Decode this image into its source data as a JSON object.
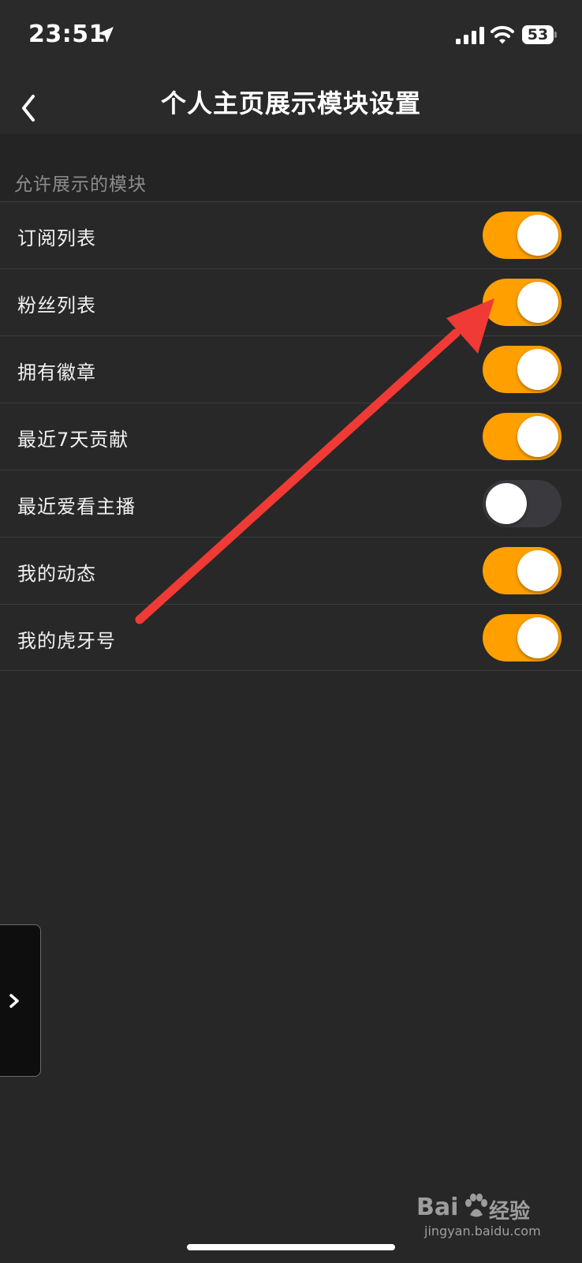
{
  "status_bar": {
    "time": "23:51",
    "battery": "53",
    "icons": [
      "location-arrow-icon",
      "signal-bars-icon",
      "wifi-icon",
      "battery-icon"
    ]
  },
  "nav": {
    "back_icon": "chevron-left-icon",
    "title": "个人主页展示模块设置"
  },
  "section": {
    "title": "允许展示的模块"
  },
  "settings": [
    {
      "label": "订阅列表",
      "enabled": true
    },
    {
      "label": "粉丝列表",
      "enabled": true
    },
    {
      "label": "拥有徽章",
      "enabled": true
    },
    {
      "label": "最近7天贡献",
      "enabled": true
    },
    {
      "label": "最近爱看主播",
      "enabled": false
    },
    {
      "label": "我的动态",
      "enabled": true
    },
    {
      "label": "我的虎牙号",
      "enabled": true
    }
  ],
  "side_tab": {
    "icon": "chevron-right-icon"
  },
  "watermark": {
    "logo": "Bai",
    "label": "经验",
    "url": "jingyan.baidu.com"
  },
  "colors": {
    "background": "#272727",
    "toggle_on": "#ffa000",
    "toggle_off": "#3a3a3e",
    "annotation_arrow": "#f03a35"
  }
}
